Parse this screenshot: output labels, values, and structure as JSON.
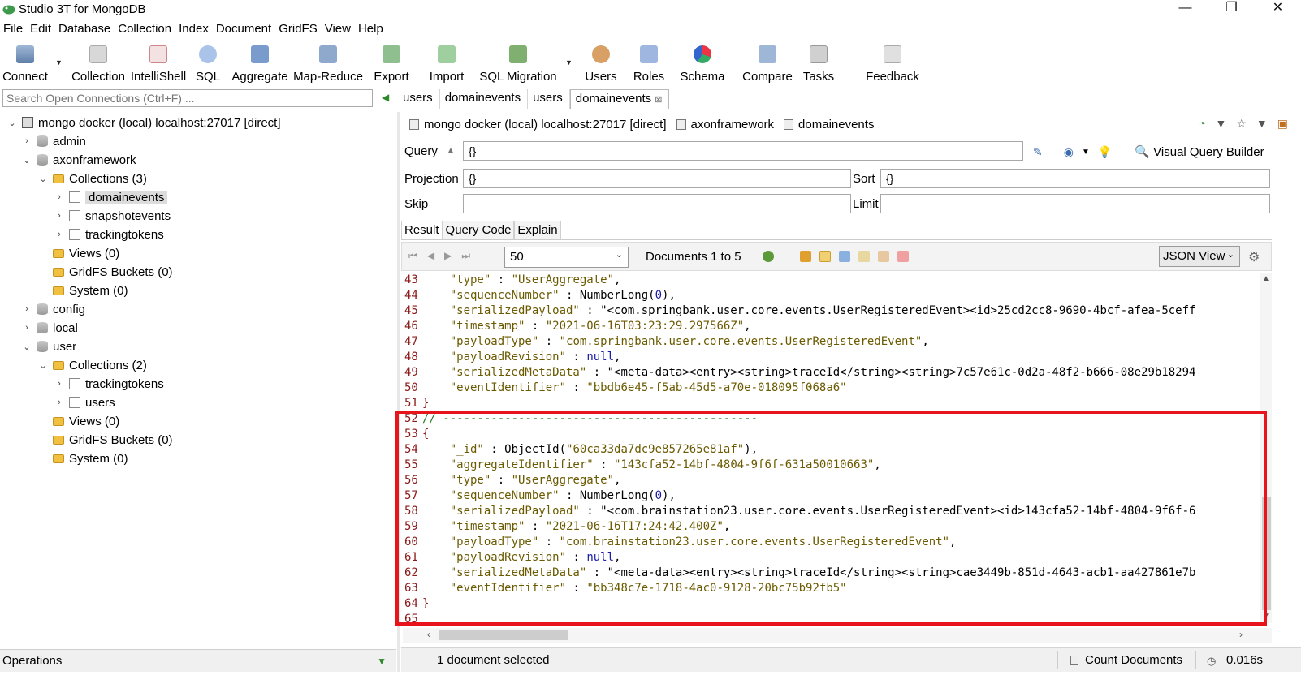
{
  "window": {
    "title": "Studio 3T for MongoDB",
    "minimize": "—",
    "restore": "❐",
    "close": "✕"
  },
  "menu": [
    "File",
    "Edit",
    "Database",
    "Collection",
    "Index",
    "Document",
    "GridFS",
    "View",
    "Help"
  ],
  "toolbar": [
    {
      "label": "Connect",
      "icon": "connect-icon"
    },
    {
      "label": "Collection",
      "icon": "collection-icon"
    },
    {
      "label": "IntelliShell",
      "icon": "intellishell-icon"
    },
    {
      "label": "SQL",
      "icon": "sql-icon"
    },
    {
      "label": "Aggregate",
      "icon": "aggregate-icon"
    },
    {
      "label": "Map-Reduce",
      "icon": "map-reduce-icon"
    },
    {
      "label": "Export",
      "icon": "export-icon"
    },
    {
      "label": "Import",
      "icon": "import-icon"
    },
    {
      "label": "SQL Migration",
      "icon": "sql-migration-icon"
    },
    {
      "label": "Users",
      "icon": "users-icon"
    },
    {
      "label": "Roles",
      "icon": "roles-icon"
    },
    {
      "label": "Schema",
      "icon": "schema-icon"
    },
    {
      "label": "Compare",
      "icon": "compare-icon"
    },
    {
      "label": "Tasks",
      "icon": "tasks-icon"
    },
    {
      "label": "Feedback",
      "icon": "feedback-icon"
    }
  ],
  "search": {
    "placeholder": "Search Open Connections (Ctrl+F) ..."
  },
  "tabs": [
    "users",
    "domainevents",
    "users",
    "domainevents"
  ],
  "tree": [
    {
      "label": "mongo docker (local) localhost:27017 [direct]",
      "type": "conn",
      "chev": "⌄"
    },
    {
      "label": "admin",
      "type": "db",
      "chev": "›"
    },
    {
      "label": "axonframework",
      "type": "db",
      "chev": "⌄"
    },
    {
      "label": "Collections (3)",
      "type": "folder",
      "chev": "⌄"
    },
    {
      "label": "domainevents",
      "type": "coll",
      "chev": "›"
    },
    {
      "label": "snapshotevents",
      "type": "coll",
      "chev": "›"
    },
    {
      "label": "trackingtokens",
      "type": "coll",
      "chev": "›"
    },
    {
      "label": "Views (0)",
      "type": "folder",
      "chev": ""
    },
    {
      "label": "GridFS Buckets (0)",
      "type": "folder",
      "chev": ""
    },
    {
      "label": "System (0)",
      "type": "folder",
      "chev": ""
    },
    {
      "label": "config",
      "type": "db",
      "chev": "›"
    },
    {
      "label": "local",
      "type": "db",
      "chev": "›"
    },
    {
      "label": "user",
      "type": "db",
      "chev": "⌄"
    },
    {
      "label": "Collections (2)",
      "type": "folder",
      "chev": "⌄"
    },
    {
      "label": "trackingtokens",
      "type": "coll",
      "chev": "›"
    },
    {
      "label": "users",
      "type": "coll",
      "chev": "›"
    },
    {
      "label": "Views (0)",
      "type": "folder",
      "chev": ""
    },
    {
      "label": "GridFS Buckets (0)",
      "type": "folder",
      "chev": ""
    },
    {
      "label": "System (0)",
      "type": "folder",
      "chev": ""
    }
  ],
  "operations": {
    "label": "Operations"
  },
  "breadcrumb": {
    "connection": "mongo docker (local) localhost:27017 [direct]",
    "database": "axonframework",
    "collection": "domainevents"
  },
  "query": {
    "query_label": "Query",
    "query_value": "{}",
    "visual_builder": "Visual Query Builder",
    "projection_label": "Projection",
    "projection_value": "{}",
    "sort_label": "Sort",
    "sort_value": "{}",
    "skip_label": "Skip",
    "skip_value": "",
    "limit_label": "Limit",
    "limit_value": ""
  },
  "result_tabs": [
    "Result",
    "Query Code",
    "Explain"
  ],
  "results": {
    "page_size": "50",
    "documents_label": "Documents 1 to 5",
    "view_mode": "JSON View"
  },
  "code_lines": [
    {
      "n": "43",
      "t": "    \"type\" : \"UserAggregate\","
    },
    {
      "n": "44",
      "t": "    \"sequenceNumber\" : NumberLong(0),"
    },
    {
      "n": "45",
      "t": "    \"serializedPayload\" : \"<com.springbank.user.core.events.UserRegisteredEvent><id>25cd2cc8-9690-4bcf-afea-5ceff"
    },
    {
      "n": "46",
      "t": "    \"timestamp\" : \"2021-06-16T03:23:29.297566Z\","
    },
    {
      "n": "47",
      "t": "    \"payloadType\" : \"com.springbank.user.core.events.UserRegisteredEvent\","
    },
    {
      "n": "48",
      "t": "    \"payloadRevision\" : null,"
    },
    {
      "n": "49",
      "t": "    \"serializedMetaData\" : \"<meta-data><entry><string>traceId</string><string>7c57e61c-0d2a-48f2-b666-08e29b18294"
    },
    {
      "n": "50",
      "t": "    \"eventIdentifier\" : \"bbdb6e45-f5ab-45d5-a70e-018095f068a6\""
    },
    {
      "n": "51",
      "t": "}"
    },
    {
      "n": "52",
      "t": "// ----------------------------------------------"
    },
    {
      "n": "53",
      "t": "{"
    },
    {
      "n": "54",
      "t": "    \"_id\" : ObjectId(\"60ca33da7dc9e857265e81af\"),"
    },
    {
      "n": "55",
      "t": "    \"aggregateIdentifier\" : \"143cfa52-14bf-4804-9f6f-631a50010663\","
    },
    {
      "n": "56",
      "t": "    \"type\" : \"UserAggregate\","
    },
    {
      "n": "57",
      "t": "    \"sequenceNumber\" : NumberLong(0),"
    },
    {
      "n": "58",
      "t": "    \"serializedPayload\" : \"<com.brainstation23.user.core.events.UserRegisteredEvent><id>143cfa52-14bf-4804-9f6f-6"
    },
    {
      "n": "59",
      "t": "    \"timestamp\" : \"2021-06-16T17:24:42.400Z\","
    },
    {
      "n": "60",
      "t": "    \"payloadType\" : \"com.brainstation23.user.core.events.UserRegisteredEvent\","
    },
    {
      "n": "61",
      "t": "    \"payloadRevision\" : null,"
    },
    {
      "n": "62",
      "t": "    \"serializedMetaData\" : \"<meta-data><entry><string>traceId</string><string>cae3449b-851d-4643-acb1-aa427861e7b"
    },
    {
      "n": "63",
      "t": "    \"eventIdentifier\" : \"bb348c7e-1718-4ac0-9128-20bc75b92fb5\""
    },
    {
      "n": "64",
      "t": "}"
    },
    {
      "n": "65",
      "t": ""
    }
  ],
  "status": {
    "selected": "1 document selected",
    "count": "Count Documents",
    "time": "0.016s"
  },
  "colors": {
    "highlight": "#e8141c",
    "line_numbers": "#8b1a1a",
    "string": "#6b5a00",
    "keyword": "#1a1aa8"
  }
}
